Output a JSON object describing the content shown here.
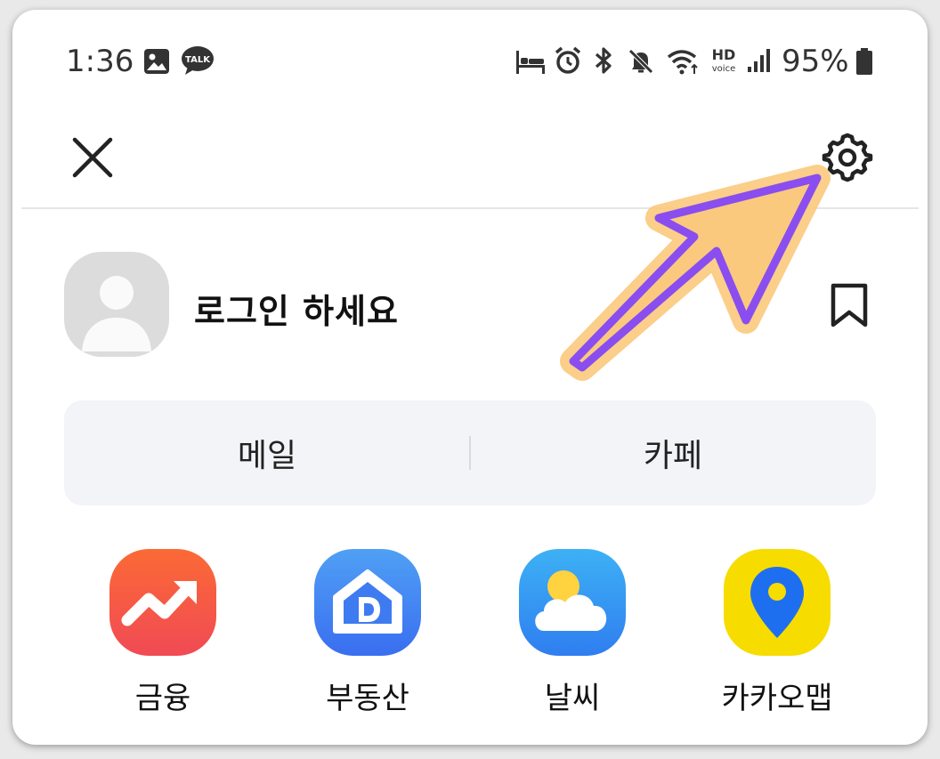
{
  "status_bar": {
    "time": "1:36",
    "talk_badge": "TALK",
    "hd_top": "HD",
    "hd_bottom": "voice",
    "battery": "95%",
    "icons": [
      "gallery-icon",
      "kakaotalk-icon",
      "sleep-mode-icon",
      "alarm-icon",
      "bluetooth-icon",
      "mute-icon",
      "wifi-icon",
      "hd-voice-icon",
      "signal-icon",
      "battery-icon"
    ]
  },
  "header": {
    "close_icon": "close-icon",
    "settings_icon": "gear-icon"
  },
  "profile": {
    "title": "로그인 하세요",
    "avatar_icon": "avatar-icon",
    "bookmark_icon": "bookmark-icon"
  },
  "segment": {
    "items": [
      {
        "label": "메일"
      },
      {
        "label": "카페"
      }
    ]
  },
  "apps": [
    {
      "label": "금융",
      "icon": "finance-trend-icon",
      "color": "#f4553b"
    },
    {
      "label": "부동산",
      "icon": "real-estate-house-icon",
      "color": "#3d7bf0"
    },
    {
      "label": "날씨",
      "icon": "weather-cloud-sun-icon",
      "color": "#2f9ef4"
    },
    {
      "label": "카카오맵",
      "icon": "map-pin-icon",
      "color": "#f7dc00"
    }
  ],
  "annotation": {
    "icon": "annotation-arrow-icon",
    "fill": "#fbc97d",
    "stroke": "#8a4df0"
  }
}
